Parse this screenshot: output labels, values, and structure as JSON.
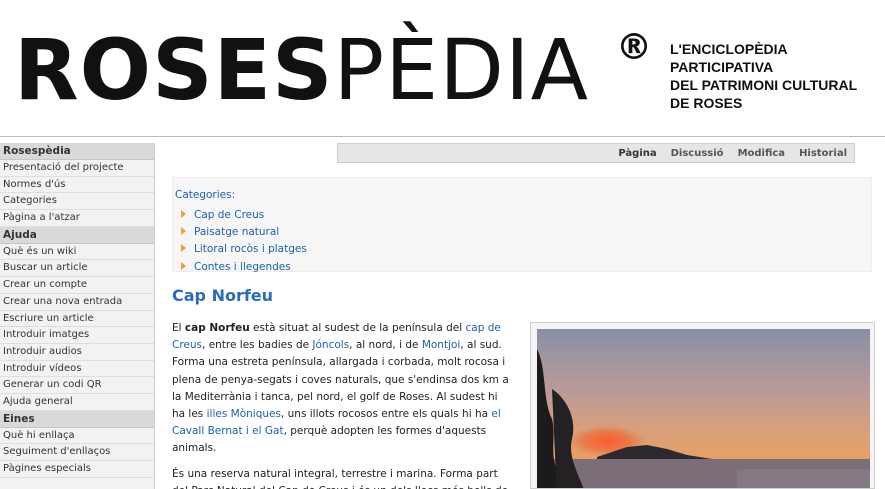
{
  "header": {
    "logo_bold": "ROSES",
    "logo_light": "PÈDIA",
    "logo_reg": "®",
    "tagline": [
      "L'ENCICLOPÈDIA",
      "PARTICIPATIVA",
      "DEL PATRIMONI CULTURAL",
      "DE ROSES"
    ]
  },
  "sidebar": {
    "sections": [
      {
        "heading": "Rosespèdia",
        "items": [
          "Presentació del projecte",
          "Normes d'ús",
          "Categories",
          "Pàgina a l'atzar"
        ]
      },
      {
        "heading": "Ajuda",
        "items": [
          "Què és un wiki",
          "Buscar un article",
          "Crear un compte",
          "Crear una nova entrada",
          "Escriure un article",
          "Introduir imatges",
          "Introduir audios",
          "Introduir vídeos",
          "Generar un codi QR",
          "Ajuda general"
        ]
      },
      {
        "heading": "Eines",
        "items": [
          "Què hi enllaça",
          "Seguiment d'enllaços",
          "Pàgines especials"
        ]
      }
    ]
  },
  "tabs": [
    "Pàgina",
    "Discussió",
    "Modifica",
    "Historial"
  ],
  "categories": {
    "title": "Categories:",
    "items": [
      "Cap de Creus",
      "Paisatge natural",
      "Litoral rocòs i platges",
      "Contes i llegendes"
    ]
  },
  "page_title": "Cap Norfeu",
  "article": {
    "p1": {
      "t1": "El ",
      "b1": "cap Norfeu",
      "t2": " està situat al sudest de la península del ",
      "l1": "cap de Creus",
      "t3": ", entre les badies de ",
      "l2": "Jóncols",
      "t4": ", al nord, i de ",
      "l3": "Montjoi",
      "t5": ", al sud. Forma una estreta península, allargada i corbada, molt rocosa i plena de penya-segats i coves naturals, que s'endinsa dos km a la Mediterrània i tanca, pel nord, el golf de Roses. Al sudest hi ha les ",
      "l4": "illes Mòniques",
      "t6": ", uns illots rocosos entre els quals hi ha ",
      "l5": "el Cavall Bernat i el Gat",
      "t7": ", perquè adopten les formes d'aquests animals."
    },
    "p2": "És una reserva natural integral, terrestre i marina. Forma part del Parc Natural del Cap de Creus i és un dels llocs més bells de"
  },
  "colors": {
    "link": "#1f5fa8",
    "title": "#2a6db5",
    "bullet": "#f0a030"
  }
}
